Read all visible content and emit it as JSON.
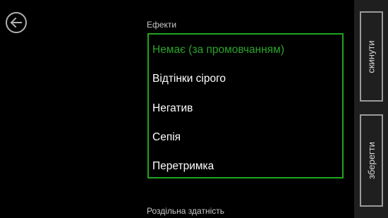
{
  "header": {
    "back_icon": "arrow-left-icon"
  },
  "effects": {
    "label": "Ефекти",
    "options": [
      "Немає (за промовчанням)",
      "Відтінки сірого",
      "Негатив",
      "Сепія",
      "Перетримка"
    ],
    "selected_index": 0,
    "accent_color": "#2ca52c"
  },
  "resolution": {
    "label": "Роздільна здатність"
  },
  "appbar": {
    "reset_label": "скинути",
    "save_label": "зберегти"
  }
}
